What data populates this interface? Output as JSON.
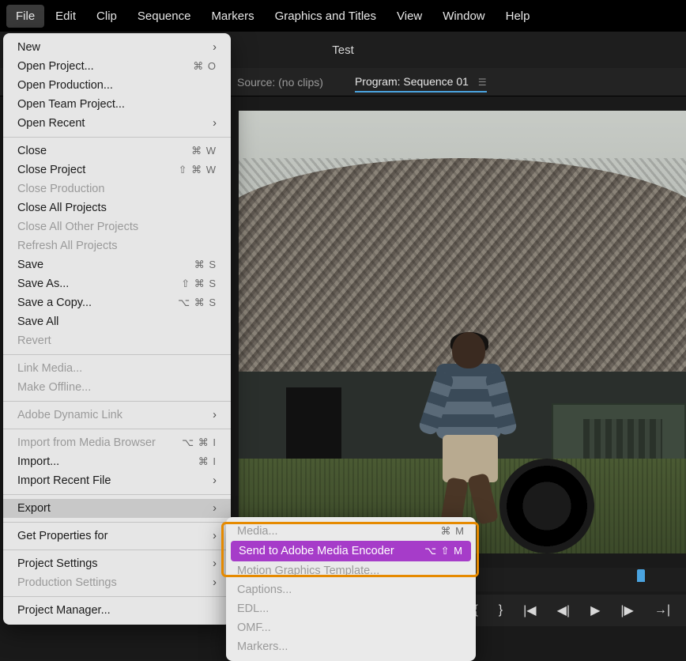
{
  "menubar": {
    "items": [
      "File",
      "Edit",
      "Clip",
      "Sequence",
      "Markers",
      "Graphics and Titles",
      "View",
      "Window",
      "Help"
    ],
    "active": "File"
  },
  "header": {
    "workspace": "Test"
  },
  "panel_tabs": {
    "source": "Source: (no clips)",
    "program": "Program: Sequence 01"
  },
  "file_menu": {
    "groups": [
      [
        {
          "label": "New",
          "submenu": true
        },
        {
          "label": "Open Project...",
          "shortcut": "⌘ O"
        },
        {
          "label": "Open Production..."
        },
        {
          "label": "Open Team Project..."
        },
        {
          "label": "Open Recent",
          "submenu": true
        }
      ],
      [
        {
          "label": "Close",
          "shortcut": "⌘ W"
        },
        {
          "label": "Close Project",
          "shortcut": "⇧ ⌘ W"
        },
        {
          "label": "Close Production",
          "disabled": true
        },
        {
          "label": "Close All Projects"
        },
        {
          "label": "Close All Other Projects",
          "disabled": true
        },
        {
          "label": "Refresh All Projects",
          "disabled": true
        },
        {
          "label": "Save",
          "shortcut": "⌘ S"
        },
        {
          "label": "Save As...",
          "shortcut": "⇧ ⌘ S"
        },
        {
          "label": "Save a Copy...",
          "shortcut": "⌥ ⌘ S"
        },
        {
          "label": "Save All"
        },
        {
          "label": "Revert",
          "disabled": true
        }
      ],
      [
        {
          "label": "Link Media...",
          "disabled": true
        },
        {
          "label": "Make Offline...",
          "disabled": true
        }
      ],
      [
        {
          "label": "Adobe Dynamic Link",
          "submenu": true,
          "disabled": true
        }
      ],
      [
        {
          "label": "Import from Media Browser",
          "shortcut": "⌥ ⌘ I",
          "disabled": true
        },
        {
          "label": "Import...",
          "shortcut": "⌘ I"
        },
        {
          "label": "Import Recent File",
          "submenu": true
        }
      ],
      [
        {
          "label": "Export",
          "submenu": true,
          "hover": true
        }
      ],
      [
        {
          "label": "Get Properties for",
          "submenu": true
        }
      ],
      [
        {
          "label": "Project Settings",
          "submenu": true
        },
        {
          "label": "Production Settings",
          "submenu": true,
          "disabled": true
        }
      ],
      [
        {
          "label": "Project Manager..."
        }
      ]
    ]
  },
  "export_submenu": {
    "items": [
      {
        "label": "Media...",
        "shortcut": "⌘ M",
        "disabled": true
      },
      {
        "label": "Send to Adobe Media Encoder",
        "shortcut": "⌥ ⇧ M",
        "selected": true
      },
      {
        "label": "Motion Graphics Template...",
        "disabled": true
      },
      {
        "label": "Captions...",
        "disabled": true
      },
      {
        "label": "EDL...",
        "disabled": true
      },
      {
        "label": "OMF...",
        "disabled": true
      },
      {
        "label": "Markers...",
        "disabled": true
      }
    ]
  },
  "transport_icons": [
    "mark-in",
    "mark-out",
    "go-to-in",
    "step-back",
    "play",
    "step-forward",
    "go-to-out"
  ]
}
